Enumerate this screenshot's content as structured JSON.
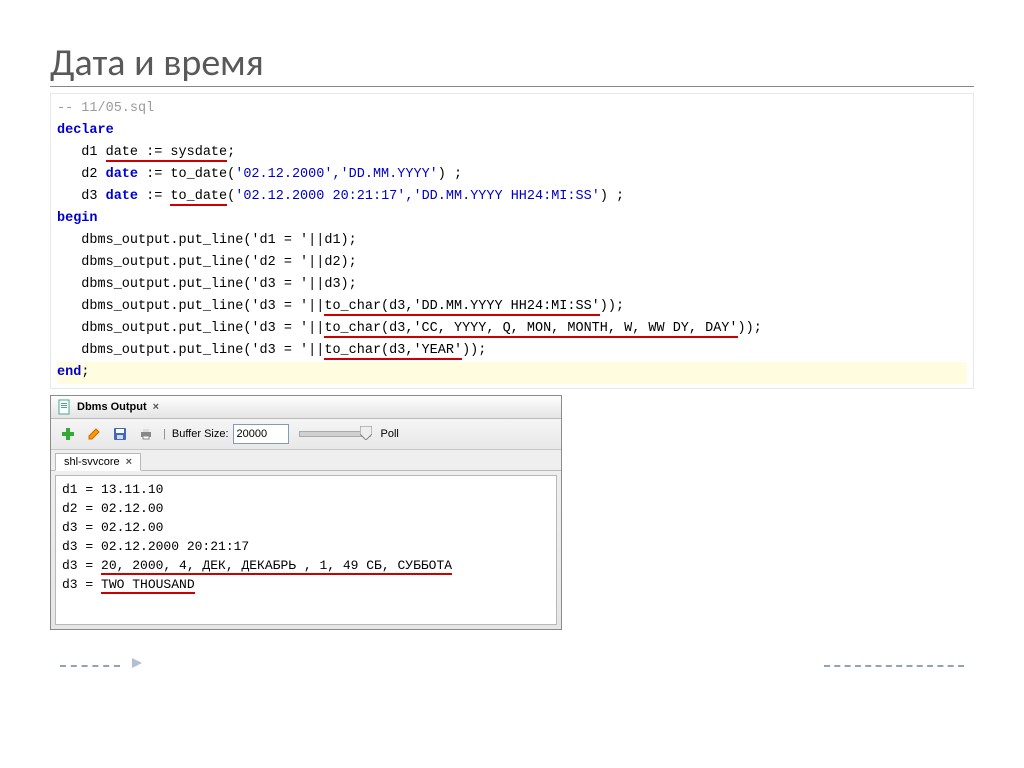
{
  "title": "Дата и время",
  "code": {
    "comment": "-- 11/05.sql",
    "kw_declare": "declare",
    "line_d1_pre": "   d1 ",
    "line_d1_hl": "date := sysdate",
    "line_d1_post": ";",
    "line_d2_pre": "   d2 ",
    "kw_date2": "date",
    "line_d2_mid": " := to_date(",
    "line_d2_str": "'02.12.2000','DD.MM.YYYY'",
    "line_d2_post": ") ;",
    "line_d3_pre": "   d3 ",
    "kw_date3": "date",
    "line_d3_mid": " := ",
    "line_d3_hl": "to_date",
    "line_d3_paren": "(",
    "line_d3_str": "'02.12.2000 20:21:17','DD.MM.YYYY HH24:MI:SS'",
    "line_d3_post": ") ;",
    "kw_begin": "begin",
    "line_o1": "   dbms_output.put_line('d1 = '||d1);",
    "line_o2": "   dbms_output.put_line('d2 = '||d2);",
    "line_o3": "   dbms_output.put_line('d3 = '||d3);",
    "line_o4_pre": "   dbms_output.put_line('d3 = '||",
    "line_o4_hl": "to_char(d3,'DD.MM.YYYY HH24:MI:SS'",
    "line_o4_post": "));",
    "line_o5_pre": "   dbms_output.put_line('d3 = '||",
    "line_o5_hl": "to_char(d3,'CC, YYYY, Q, MON, MONTH, W, WW DY, DAY'",
    "line_o5_post": "));",
    "line_o6_pre": "   dbms_output.put_line('d3 = '||",
    "line_o6_hl": "to_char(d3,'YEAR'",
    "line_o6_post": "));",
    "kw_end": "end",
    "end_semi": ";"
  },
  "dbms": {
    "title": "Dbms Output",
    "buffer_label": "Buffer Size:",
    "buffer_value": "20000",
    "poll_label": "Poll",
    "tab": "shl-svvcore",
    "out1": "d1 = 13.11.10",
    "out2": "d2 = 02.12.00",
    "out3": "d3 = 02.12.00",
    "out4": "d3 = 02.12.2000 20:21:17",
    "out5_pre": "d3 = ",
    "out5_hl": "20, 2000, 4, ДЕК, ДЕКАБРЬ , 1, 49 СБ, СУББОТА",
    "out6_pre": "d3 = ",
    "out6_hl": "TWO THOUSAND"
  }
}
